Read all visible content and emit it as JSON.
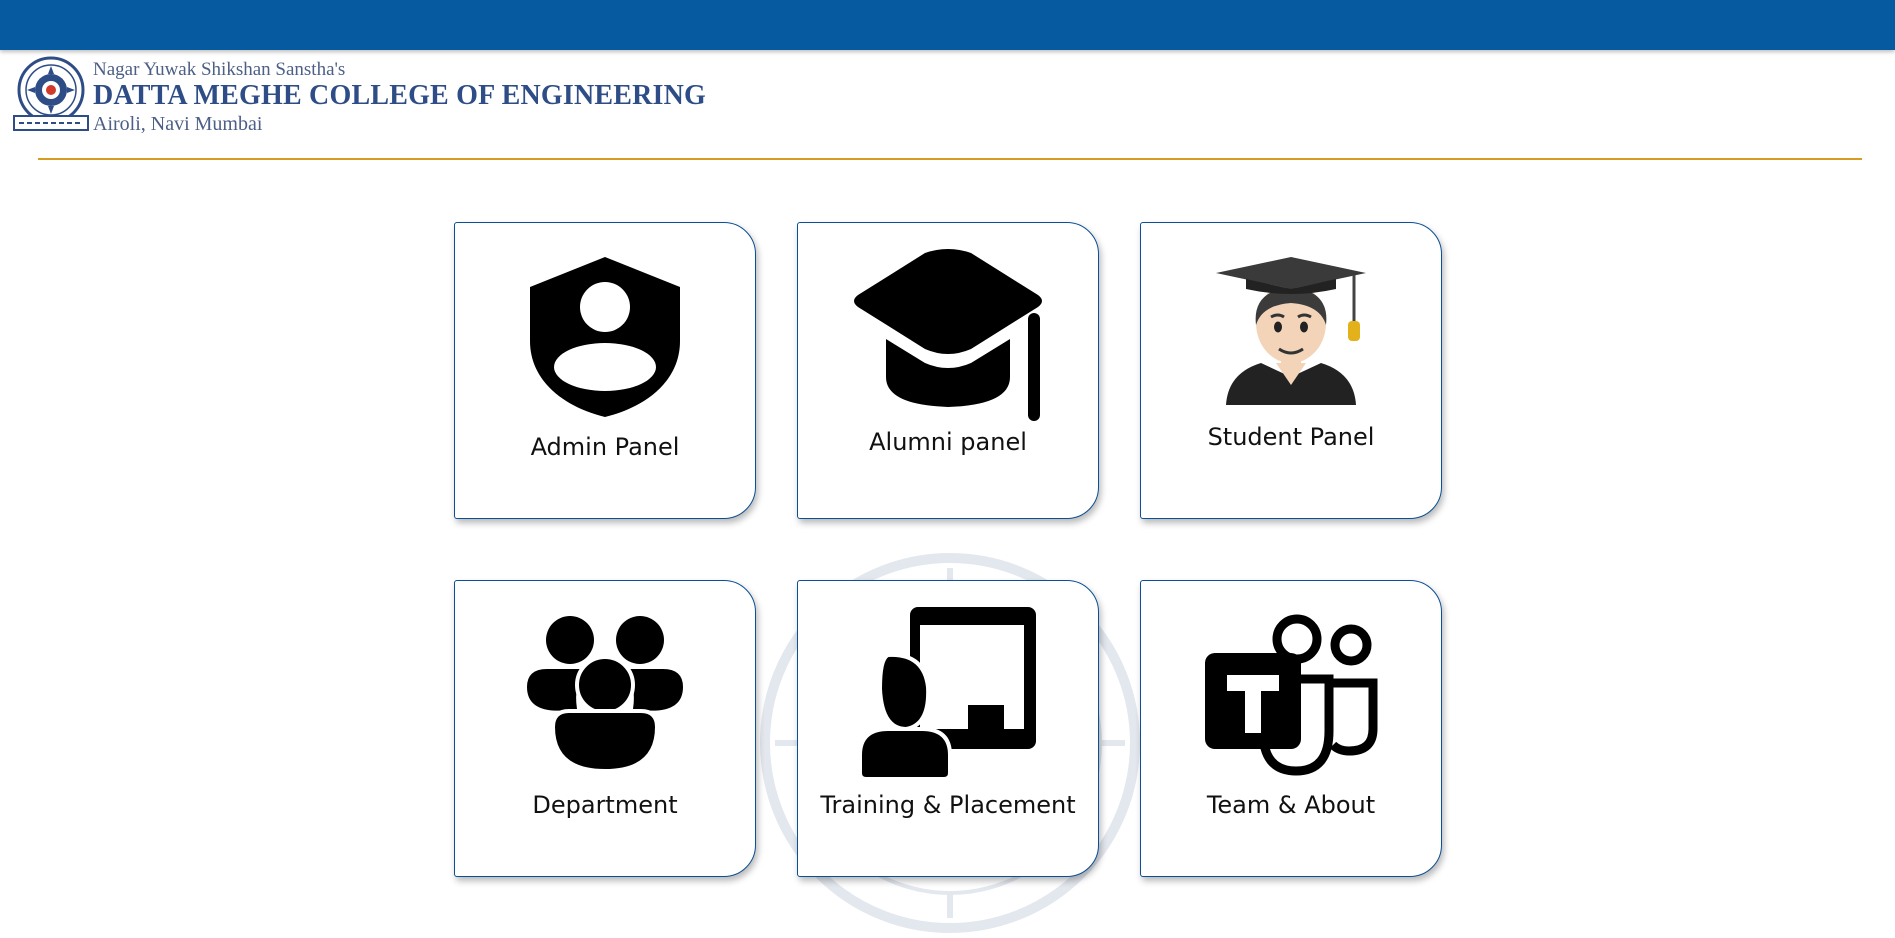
{
  "header": {
    "trust_name": "Nagar Yuwak Shikshan Sanstha's",
    "college_name": "DATTA MEGHE COLLEGE OF ENGINEERING",
    "location": "Airoli, Navi Mumbai"
  },
  "colors": {
    "topbar": "#065aa0",
    "divider": "#d79d22",
    "card_border": "#0b4f94",
    "text": "#111111"
  },
  "cards": [
    {
      "label": "Admin Panel",
      "icon": "shield-person-icon"
    },
    {
      "label": "Alumni panel",
      "icon": "graduation-cap-icon"
    },
    {
      "label": "Student Panel",
      "icon": "student-emoji-icon"
    },
    {
      "label": "Department",
      "icon": "people-group-icon"
    },
    {
      "label": "Training & Placement",
      "icon": "presenter-board-icon"
    },
    {
      "label": "Team & About",
      "icon": "teams-logo-icon"
    }
  ]
}
